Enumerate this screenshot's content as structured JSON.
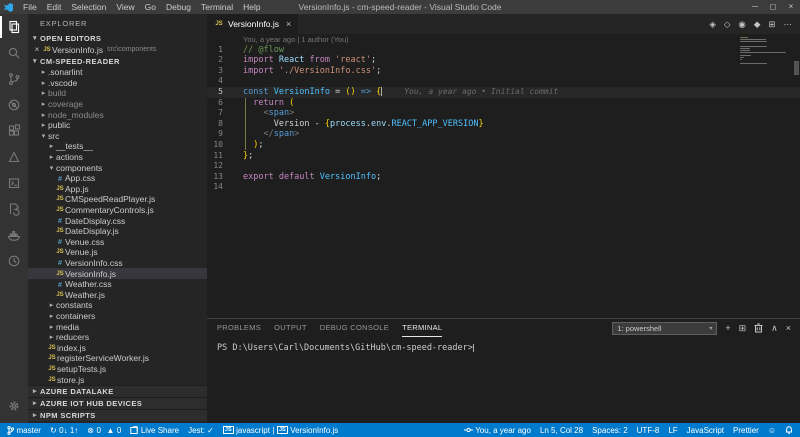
{
  "colors": {
    "title_bar": "#3c3c3c",
    "activity_bar": "#333333",
    "sidebar": "#252526",
    "editor_bg": "#1e1e1e",
    "status_bar": "#007acc",
    "selection_row": "#37373d",
    "js_badge": "#d6c34f",
    "css_badge": "#519aba"
  },
  "title_bar": {
    "title": "VersionInfo.js - cm-speed-reader - Visual Studio Code",
    "menus": [
      "File",
      "Edit",
      "Selection",
      "View",
      "Go",
      "Debug",
      "Terminal",
      "Help"
    ],
    "window_controls": {
      "minimize": "─",
      "maximize": "◻",
      "close": "×"
    }
  },
  "activity_bar": {
    "icons": [
      "explorer-icon",
      "search-icon",
      "source-control-icon",
      "debug-icon",
      "extensions-icon",
      "azure-icon",
      "azure-iot-icon",
      "test-explorer-icon",
      "docker-icon",
      "code-time-icon",
      "settings-gear-icon"
    ],
    "active": "explorer-icon"
  },
  "sidebar": {
    "title": "EXPLORER",
    "open_editors": {
      "header": "OPEN EDITORS",
      "items": [
        {
          "close": "×",
          "name": "VersionInfo.js",
          "path": "src\\components"
        }
      ]
    },
    "project_header": "CM-SPEED-READER",
    "tree": [
      {
        "label": ".sonarlint",
        "kind": "folder",
        "expanded": false,
        "depth": 0
      },
      {
        "label": ".vscode",
        "kind": "folder",
        "expanded": false,
        "depth": 0
      },
      {
        "label": "build",
        "kind": "folder",
        "expanded": false,
        "depth": 0,
        "dimmed": true
      },
      {
        "label": "coverage",
        "kind": "folder",
        "expanded": false,
        "depth": 0,
        "dimmed": true
      },
      {
        "label": "node_modules",
        "kind": "folder",
        "expanded": false,
        "depth": 0,
        "dimmed": true
      },
      {
        "label": "public",
        "kind": "folder",
        "expanded": false,
        "depth": 0
      },
      {
        "label": "src",
        "kind": "folder",
        "expanded": true,
        "depth": 0
      },
      {
        "label": "__tests__",
        "kind": "folder",
        "expanded": false,
        "depth": 1
      },
      {
        "label": "actions",
        "kind": "folder",
        "expanded": false,
        "depth": 1
      },
      {
        "label": "components",
        "kind": "folder",
        "expanded": true,
        "depth": 1
      },
      {
        "label": "App.css",
        "kind": "css",
        "depth": 2
      },
      {
        "label": "App.js",
        "kind": "js",
        "depth": 2
      },
      {
        "label": "CMSpeedReadPlayer.js",
        "kind": "js",
        "depth": 2
      },
      {
        "label": "CommentaryControls.js",
        "kind": "js",
        "depth": 2
      },
      {
        "label": "DateDisplay.css",
        "kind": "css",
        "depth": 2
      },
      {
        "label": "DateDisplay.js",
        "kind": "js",
        "depth": 2
      },
      {
        "label": "Venue.css",
        "kind": "css",
        "depth": 2
      },
      {
        "label": "Venue.js",
        "kind": "js",
        "depth": 2
      },
      {
        "label": "VersionInfo.css",
        "kind": "css",
        "depth": 2
      },
      {
        "label": "VersionInfo.js",
        "kind": "js",
        "depth": 2,
        "selected": true
      },
      {
        "label": "Weather.css",
        "kind": "css",
        "depth": 2
      },
      {
        "label": "Weather.js",
        "kind": "js",
        "depth": 2
      },
      {
        "label": "constants",
        "kind": "folder",
        "expanded": false,
        "depth": 1
      },
      {
        "label": "containers",
        "kind": "folder",
        "expanded": false,
        "depth": 1
      },
      {
        "label": "media",
        "kind": "folder",
        "expanded": false,
        "depth": 1
      },
      {
        "label": "reducers",
        "kind": "folder",
        "expanded": false,
        "depth": 1
      },
      {
        "label": "index.js",
        "kind": "js",
        "depth": 1
      },
      {
        "label": "registerServiceWorker.js",
        "kind": "js",
        "depth": 1
      },
      {
        "label": "setupTests.js",
        "kind": "js",
        "depth": 1
      },
      {
        "label": "store.js",
        "kind": "js",
        "depth": 1
      }
    ],
    "bottom_sections": [
      "AZURE DATALAKE",
      "AZURE IOT HUB DEVICES",
      "NPM SCRIPTS"
    ]
  },
  "editor": {
    "tab": {
      "label": "VersionInfo.js",
      "close": "×"
    },
    "actions": [
      "open-changes-icon",
      "gitlens-icon",
      "toggle-blame-icon",
      "compare-icon",
      "split-editor-icon",
      "more-actions-icon"
    ],
    "action_glyphs": [
      "◈",
      "◇",
      "◉",
      "◆",
      "⊞",
      "⋯"
    ],
    "blame_lens": "You, a year ago | 1 author (You)",
    "lines": [
      {
        "n": 1,
        "tokens": [
          [
            "c",
            "// @flow"
          ]
        ]
      },
      {
        "n": 2,
        "tokens": [
          [
            "k",
            "import "
          ],
          [
            "v",
            "React"
          ],
          [
            "k",
            " from "
          ],
          [
            "s",
            "'react'"
          ],
          [
            "p",
            ";"
          ]
        ]
      },
      {
        "n": 3,
        "tokens": [
          [
            "k",
            "import "
          ],
          [
            "s",
            "'./VersionInfo.css'"
          ],
          [
            "p",
            ";"
          ]
        ]
      },
      {
        "n": 4,
        "tokens": []
      },
      {
        "n": 5,
        "tokens": [
          [
            "kb",
            "const "
          ],
          [
            "fn",
            "VersionInfo"
          ],
          [
            "p",
            " = "
          ],
          [
            "g",
            "()"
          ],
          [
            "kb",
            " => "
          ],
          [
            "g",
            "{"
          ]
        ],
        "cursor": true,
        "annotation": "You, a year ago • Initial commit"
      },
      {
        "n": 6,
        "tokens": [
          [
            "p",
            "  "
          ],
          [
            "k",
            "return"
          ],
          [
            "p",
            " "
          ],
          [
            "g",
            "("
          ]
        ]
      },
      {
        "n": 7,
        "tokens": [
          [
            "p",
            "    "
          ],
          [
            "tp",
            "<"
          ],
          [
            "tn",
            "span"
          ],
          [
            "tp",
            ">"
          ]
        ]
      },
      {
        "n": 8,
        "tokens": [
          [
            "p",
            "      Version - "
          ],
          [
            "g",
            "{"
          ],
          [
            "v",
            "process"
          ],
          [
            "p",
            "."
          ],
          [
            "v",
            "env"
          ],
          [
            "p",
            "."
          ],
          [
            "fn",
            "REACT_APP_VERSION"
          ],
          [
            "g",
            "}"
          ]
        ]
      },
      {
        "n": 9,
        "tokens": [
          [
            "p",
            "    "
          ],
          [
            "tp",
            "</"
          ],
          [
            "tn",
            "span"
          ],
          [
            "tp",
            ">"
          ]
        ]
      },
      {
        "n": 10,
        "tokens": [
          [
            "p",
            "  "
          ],
          [
            "g",
            ")"
          ],
          [
            "p",
            ";"
          ]
        ]
      },
      {
        "n": 11,
        "tokens": [
          [
            "g",
            "}"
          ],
          [
            "p",
            ";"
          ]
        ]
      },
      {
        "n": 12,
        "tokens": []
      },
      {
        "n": 13,
        "tokens": [
          [
            "k",
            "export default "
          ],
          [
            "fn",
            "VersionInfo"
          ],
          [
            "p",
            ";"
          ]
        ]
      },
      {
        "n": 14,
        "tokens": []
      }
    ]
  },
  "panel": {
    "tabs": [
      "PROBLEMS",
      "OUTPUT",
      "DEBUG CONSOLE",
      "TERMINAL"
    ],
    "active_tab": "TERMINAL",
    "terminal_selector": "1: powershell",
    "controls": [
      "new-terminal-icon",
      "split-terminal-icon",
      "kill-terminal-icon",
      "maximize-panel-icon",
      "close-panel-icon"
    ],
    "control_glyphs": [
      "+",
      "⊞",
      "",
      "∧",
      "×"
    ],
    "prompt": "PS D:\\Users\\Carl\\Documents\\GitHub\\cm-speed-reader>"
  },
  "status_bar": {
    "left": {
      "branch": "master",
      "sync": "0↓ 1↑",
      "errors": "0",
      "warnings": "0",
      "live_share": "Live Share",
      "jest": "Jest: ✓",
      "language_item": "javascript",
      "separator": "|",
      "file_item": "VersionInfo.js"
    },
    "right": {
      "blame": "You, a year ago",
      "position": "Ln 5, Col 28",
      "indentation": "Spaces: 2",
      "encoding": "UTF-8",
      "eol": "LF",
      "language": "JavaScript",
      "formatter": "Prettier"
    }
  }
}
